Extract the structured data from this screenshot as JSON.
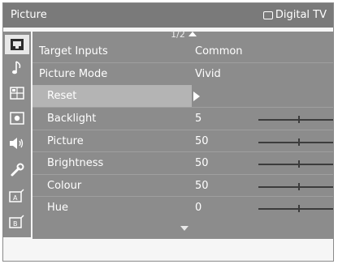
{
  "window": {
    "title": "Picture",
    "source": "Digital TV"
  },
  "pager": {
    "text": "1/2"
  },
  "sidebar": {
    "items": [
      {
        "icon": "picture-icon",
        "active": true
      },
      {
        "icon": "music-note-icon",
        "active": false
      },
      {
        "icon": "grid-icon",
        "active": false
      },
      {
        "icon": "lock-box-icon",
        "active": false
      },
      {
        "icon": "speaker-icon",
        "active": false
      },
      {
        "icon": "wrench-icon",
        "active": false
      },
      {
        "icon": "input-a-icon",
        "active": false
      },
      {
        "icon": "input-b-icon",
        "active": false
      }
    ]
  },
  "menu": {
    "target_inputs": {
      "label": "Target Inputs",
      "value": "Common"
    },
    "picture_mode": {
      "label": "Picture Mode",
      "value": "Vivid"
    },
    "reset": {
      "label": "Reset"
    },
    "backlight": {
      "label": "Backlight",
      "value": "5",
      "level": 0.5
    },
    "picture": {
      "label": "Picture",
      "value": "50",
      "level": 0.5
    },
    "brightness": {
      "label": "Brightness",
      "value": "50",
      "level": 0.5
    },
    "colour": {
      "label": "Colour",
      "value": "50",
      "level": 0.5
    },
    "hue": {
      "label": "Hue",
      "value": "0",
      "level": 0.5
    }
  }
}
